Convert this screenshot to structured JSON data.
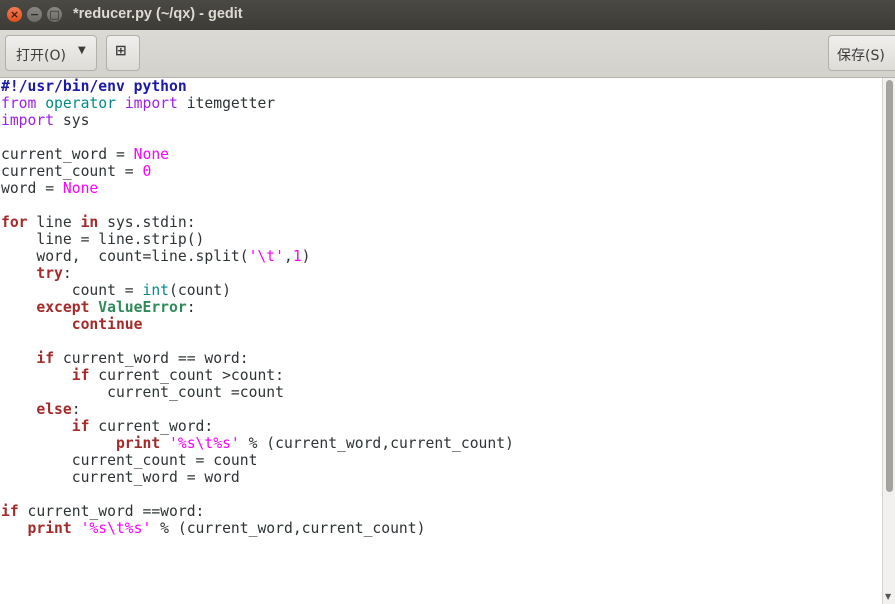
{
  "window": {
    "title": "*reducer.py (~/qx) - gedit",
    "close_glyph": "×",
    "min_glyph": "−",
    "max_glyph": "□"
  },
  "toolbar": {
    "open_label": "打开(O)",
    "open_arrow": "▼",
    "new_tab_glyph": "⊞",
    "save_label": "保存(S)"
  },
  "editor": {
    "lines": [
      "#!/usr/bin/env python",
      "from operator import itemgetter",
      "import sys",
      "",
      "current_word = None",
      "current_count = 0",
      "word = None",
      "",
      "for line in sys.stdin:",
      "    line = line.strip()",
      "    word,  count=line.split('\\t',1)",
      "    try:",
      "        count = int(count)",
      "    except ValueError:",
      "        continue",
      "",
      "    if current_word == word:",
      "        if current_count >count:",
      "            current_count =count",
      "    else:",
      "        if current_word:",
      "             print '%s\\t%s' % (current_word,current_count)",
      "        current_count = count",
      "        current_word = word",
      "",
      "if current_word ==word:",
      "   print '%s\\t%s' % (current_word,current_count)"
    ]
  },
  "colors": {
    "keyword": "#a52a2a",
    "import": "#a020f0",
    "constant": "#ff00ff",
    "builtin": "#008a8c",
    "type": "#2e8b57",
    "preprocessor": "#1a1aa6"
  }
}
